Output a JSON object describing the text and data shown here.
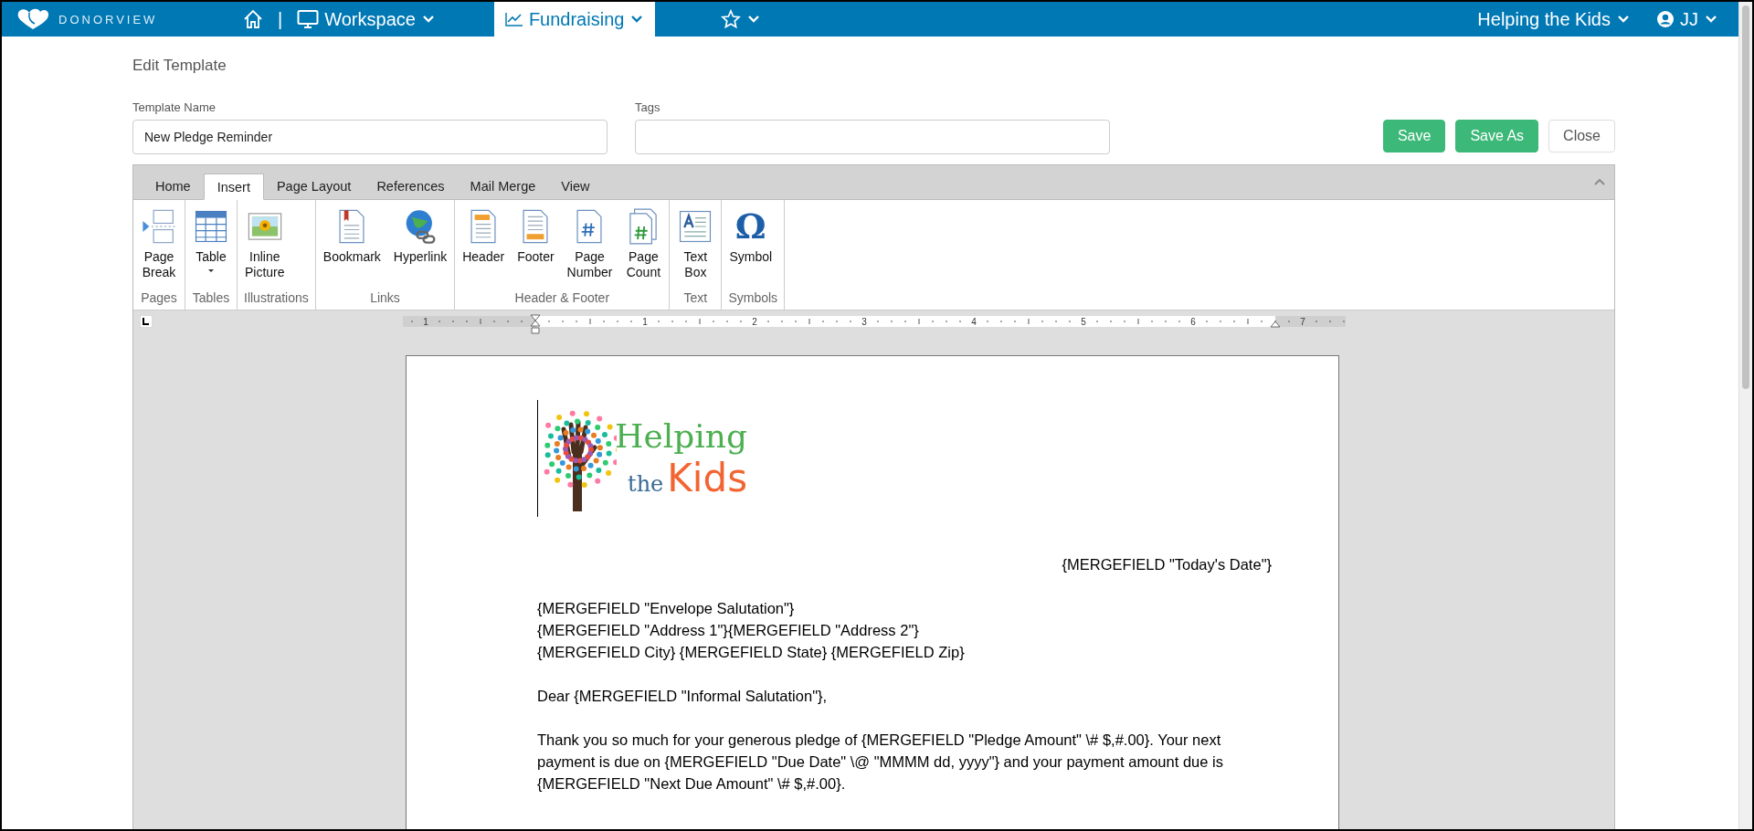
{
  "nav": {
    "brand": "DONORVIEW",
    "separator": "|",
    "items": [
      {
        "kind": "home",
        "selected": false
      },
      {
        "kind": "workspace",
        "label": "Workspace",
        "selected": false
      },
      {
        "kind": "fundraising",
        "label": "Fundraising",
        "selected": true
      },
      {
        "kind": "favorites",
        "selected": false
      }
    ],
    "organization": "Helping the Kids",
    "user": "JJ"
  },
  "page": {
    "title": "Edit Template",
    "fields": [
      {
        "label": "Template Name",
        "value": "New Pledge Reminder"
      },
      {
        "label": "Tags"
      }
    ],
    "buttons": [
      {
        "label": "Save",
        "kind": "primary"
      },
      {
        "label": "Save As",
        "kind": "primary"
      },
      {
        "label": "Close",
        "kind": "default"
      }
    ]
  },
  "ribbon": {
    "tabs": [
      {
        "label": "Home",
        "selected": false
      },
      {
        "label": "Insert",
        "selected": true
      },
      {
        "label": "Page Layout",
        "selected": false
      },
      {
        "label": "References",
        "selected": false
      },
      {
        "label": "Mail Merge",
        "selected": false
      },
      {
        "label": "View",
        "selected": false
      }
    ],
    "groups": [
      {
        "label": "Pages",
        "commands": [
          {
            "kind": "page-break",
            "label": "Page\nBreak"
          }
        ]
      },
      {
        "label": "Tables",
        "commands": [
          {
            "kind": "table",
            "label": "Table",
            "menu": true
          }
        ]
      },
      {
        "label": "Illustrations",
        "commands": [
          {
            "kind": "picture",
            "label": "Inline\nPicture"
          }
        ]
      },
      {
        "label": "Links",
        "commands": [
          {
            "kind": "bookmark",
            "label": "Bookmark"
          },
          {
            "kind": "hyperlink",
            "label": "Hyperlink"
          }
        ]
      },
      {
        "label": "Header & Footer",
        "commands": [
          {
            "kind": "header",
            "label": "Header"
          },
          {
            "kind": "footer",
            "label": "Footer"
          },
          {
            "kind": "page-number",
            "label": "Page\nNumber"
          },
          {
            "kind": "page-count",
            "label": "Page\nCount"
          }
        ]
      },
      {
        "label": "Text",
        "commands": [
          {
            "kind": "text-box",
            "label": "Text\nBox"
          }
        ]
      },
      {
        "label": "Symbols",
        "commands": [
          {
            "kind": "symbol",
            "glyph": "Ω",
            "label": "Symbol"
          }
        ]
      }
    ]
  },
  "ruler": {
    "numbers": [
      "1",
      "1",
      "2",
      "3",
      "4",
      "5",
      "6",
      "7"
    ]
  },
  "document": {
    "logo": {
      "line1": "Helping",
      "line2": "the",
      "line3": "Kids"
    },
    "date_line": "{MERGEFIELD \"Today's Date\"}",
    "address_lines": [
      "{MERGEFIELD \"Envelope Salutation\"}",
      "{MERGEFIELD \"Address 1\"}{MERGEFIELD \"Address 2\"}",
      "{MERGEFIELD City} {MERGEFIELD State} {MERGEFIELD Zip}"
    ],
    "greeting": "Dear {MERGEFIELD \"Informal Salutation\"},",
    "body": "Thank you so much for your generous pledge of {MERGEFIELD \"Pledge Amount\" \\# $,#.00}.  Your next payment is due on {MERGEFIELD \"Due Date\" \\@ \"MMMM dd, yyyy\"} and your payment amount due is {MERGEFIELD \"Next Due Amount\" \\# $,#.00}."
  }
}
